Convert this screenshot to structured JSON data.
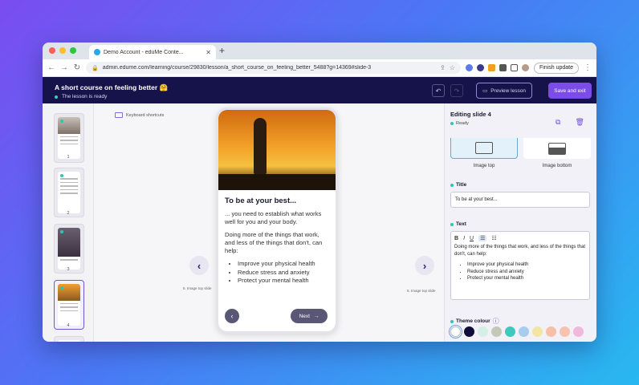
{
  "browser": {
    "tab_title": "Demo Account - eduMe Conte...",
    "url": "admin.edume.com/learning/course/29830/lesson/a_short_course_on_feeling_better_5488?g=14369#slide-3",
    "finish_update_label": "Finish update",
    "colors": {
      "close": "#ff5f57",
      "minimize": "#febc2e",
      "maximize": "#28c840"
    }
  },
  "header": {
    "course_title": "A short course on feeling better 🤗",
    "status": "The lesson is ready",
    "preview_label": "Preview lesson",
    "save_label": "Save and exit"
  },
  "slides": [
    {
      "number": "1"
    },
    {
      "number": "2"
    },
    {
      "number": "3"
    },
    {
      "number": "4"
    }
  ],
  "canvas": {
    "keyboard_shortcuts": "Keyboard shortcuts",
    "prev_caption": "5. Image top slide",
    "next_caption": "5. Image top slide"
  },
  "phone": {
    "title": "To be at your best...",
    "paragraph1": "... you need to establish what works well for you and your body.",
    "paragraph2": "Doing more of the things that work, and less of the things that don't, can help:",
    "bullets": [
      "Improve your physical health",
      "Reduce stress and anxiety",
      "Protect your mental health"
    ],
    "next_label": "Next"
  },
  "editor": {
    "heading": "Editing slide 4",
    "status": "Ready",
    "layout_top_label": "Image top",
    "layout_bottom_label": "Image bottom",
    "title_label": "Title",
    "title_value": "To be at your best...",
    "text_label": "Text",
    "text_paragraph": "Doing more of the things that work, and less of the things that don't, can help:",
    "text_bullets": [
      "Improve your physical health",
      "Reduce stress and anxiety",
      "Protect your mental health"
    ],
    "theme_label": "Theme colour",
    "theme_colors": [
      "#ffffff",
      "#0f0c3a",
      "#d3efe6",
      "#c4c8b8",
      "#3ec9bd",
      "#a6cdeb",
      "#f2e6a4",
      "#f6bfa8",
      "#f7c2b0",
      "#f2b8dc"
    ]
  },
  "colors": {
    "accent": "#7c4ce8",
    "header_bg": "#16124a",
    "ready_green": "#36d3b0"
  }
}
